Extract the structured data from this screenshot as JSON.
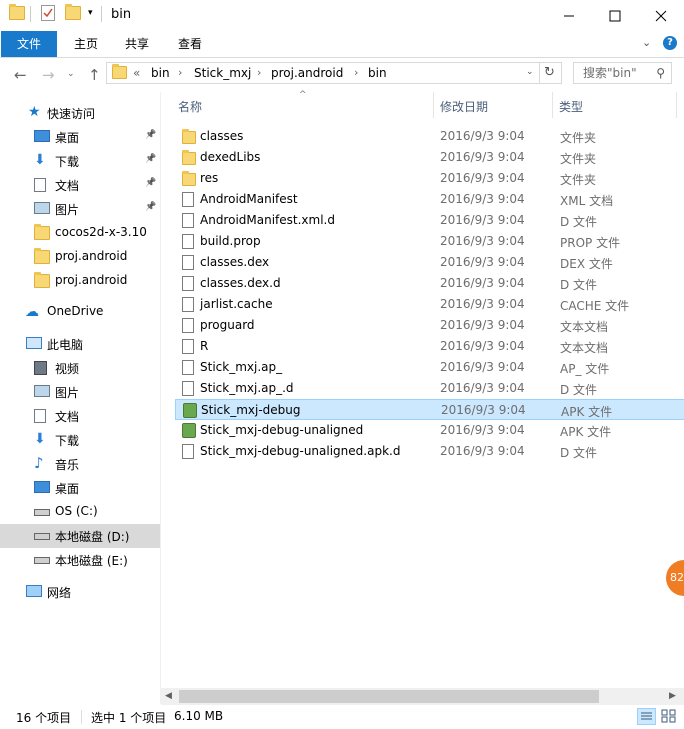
{
  "window": {
    "title": "bin"
  },
  "ribbon": {
    "tabs": [
      "文件",
      "主页",
      "共享",
      "查看"
    ]
  },
  "address": {
    "crumbs": [
      "«",
      "bin",
      "Stick_mxj",
      "proj.android",
      "bin"
    ],
    "search_placeholder": "搜索\"bin\""
  },
  "nav": {
    "quick_access": "快速访问",
    "quick_items": [
      {
        "label": "桌面",
        "icon": "desktop-icon",
        "pinned": true
      },
      {
        "label": "下载",
        "icon": "download-icon",
        "pinned": true
      },
      {
        "label": "文档",
        "icon": "document-icon",
        "pinned": true
      },
      {
        "label": "图片",
        "icon": "picture-icon",
        "pinned": true
      },
      {
        "label": "cocos2d-x-3.10",
        "icon": "folder-icon",
        "pinned": false
      },
      {
        "label": "proj.android",
        "icon": "folder-icon",
        "pinned": false
      },
      {
        "label": "proj.android",
        "icon": "folder-icon",
        "pinned": false
      }
    ],
    "onedrive": "OneDrive",
    "this_pc": "此电脑",
    "pc_items": [
      {
        "label": "视频",
        "icon": "video-icon"
      },
      {
        "label": "图片",
        "icon": "picture-icon"
      },
      {
        "label": "文档",
        "icon": "document-icon"
      },
      {
        "label": "下载",
        "icon": "download-icon"
      },
      {
        "label": "音乐",
        "icon": "music-icon"
      },
      {
        "label": "桌面",
        "icon": "desktop-icon"
      },
      {
        "label": "OS (C:)",
        "icon": "drive-icon"
      },
      {
        "label": "本地磁盘 (D:)",
        "icon": "drive-icon"
      },
      {
        "label": "本地磁盘 (E:)",
        "icon": "drive-icon"
      }
    ],
    "network": "网络"
  },
  "list": {
    "columns": [
      "名称",
      "修改日期",
      "类型"
    ],
    "rows": [
      {
        "name": "classes",
        "date": "2016/9/3 9:04",
        "type": "文件夹",
        "icon": "folder-icon"
      },
      {
        "name": "dexedLibs",
        "date": "2016/9/3 9:04",
        "type": "文件夹",
        "icon": "folder-icon"
      },
      {
        "name": "res",
        "date": "2016/9/3 9:04",
        "type": "文件夹",
        "icon": "folder-icon"
      },
      {
        "name": "AndroidManifest",
        "date": "2016/9/3 9:04",
        "type": "XML 文档",
        "icon": "xml-file-icon"
      },
      {
        "name": "AndroidManifest.xml.d",
        "date": "2016/9/3 9:04",
        "type": "D 文件",
        "icon": "file-icon"
      },
      {
        "name": "build.prop",
        "date": "2016/9/3 9:04",
        "type": "PROP 文件",
        "icon": "file-icon"
      },
      {
        "name": "classes.dex",
        "date": "2016/9/3 9:04",
        "type": "DEX 文件",
        "icon": "file-icon"
      },
      {
        "name": "classes.dex.d",
        "date": "2016/9/3 9:04",
        "type": "D 文件",
        "icon": "file-icon"
      },
      {
        "name": "jarlist.cache",
        "date": "2016/9/3 9:04",
        "type": "CACHE 文件",
        "icon": "file-icon"
      },
      {
        "name": "proguard",
        "date": "2016/9/3 9:04",
        "type": "文本文档",
        "icon": "text-file-icon"
      },
      {
        "name": "R",
        "date": "2016/9/3 9:04",
        "type": "文本文档",
        "icon": "text-file-icon"
      },
      {
        "name": "Stick_mxj.ap_",
        "date": "2016/9/3 9:04",
        "type": "AP_ 文件",
        "icon": "file-icon"
      },
      {
        "name": "Stick_mxj.ap_.d",
        "date": "2016/9/3 9:04",
        "type": "D 文件",
        "icon": "file-icon"
      },
      {
        "name": "Stick_mxj-debug",
        "date": "2016/9/3 9:04",
        "type": "APK 文件",
        "icon": "apk-icon",
        "selected": true
      },
      {
        "name": "Stick_mxj-debug-unaligned",
        "date": "2016/9/3 9:04",
        "type": "APK 文件",
        "icon": "apk-icon"
      },
      {
        "name": "Stick_mxj-debug-unaligned.apk.d",
        "date": "2016/9/3 9:04",
        "type": "D 文件",
        "icon": "file-icon"
      }
    ]
  },
  "status": {
    "count": "16 个项目",
    "selection": "选中 1 个项目",
    "size": "6.10 MB"
  },
  "badge": {
    "text": "82"
  }
}
